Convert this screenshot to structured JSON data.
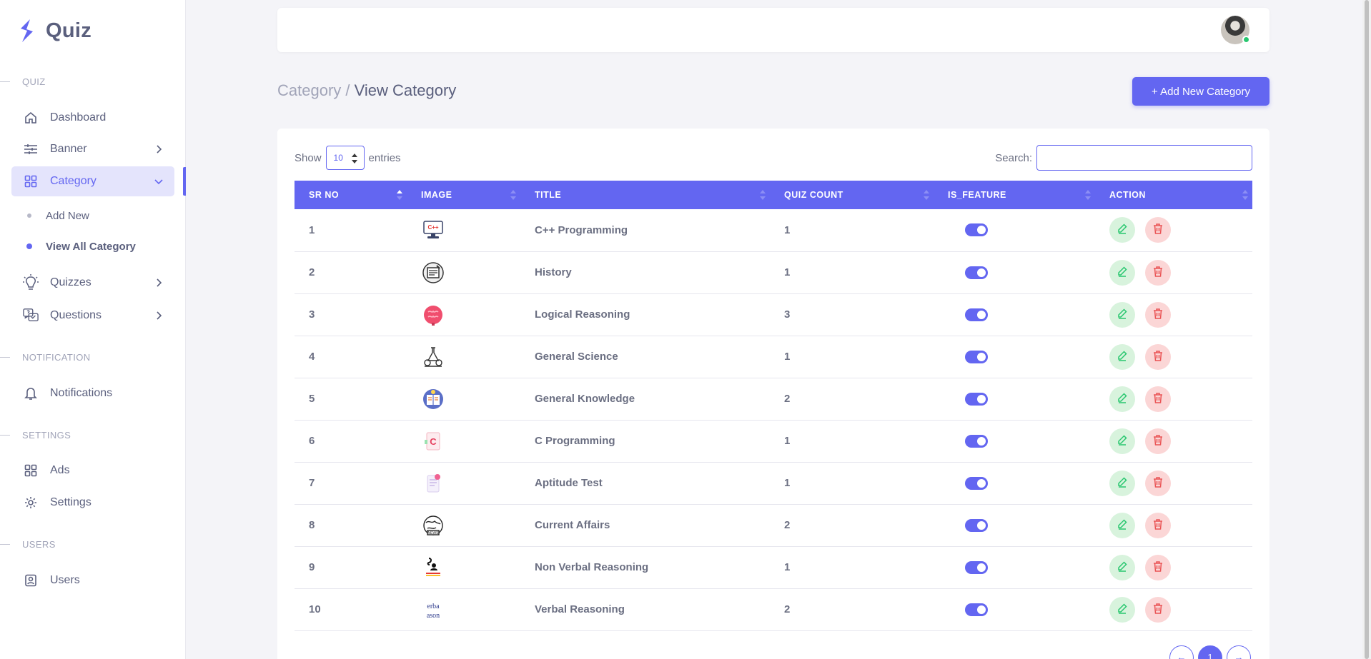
{
  "brand": {
    "name": "Quiz"
  },
  "sidebar": {
    "sections": {
      "quiz": "QUIZ",
      "notification": "NOTIFICATION",
      "settings": "SETTINGS",
      "users": "USERS"
    },
    "items": {
      "dashboard": "Dashboard",
      "banner": "Banner",
      "category": "Category",
      "add_new": "Add New",
      "view_all": "View All Category",
      "quizzes": "Quizzes",
      "questions": "Questions",
      "notifications": "Notifications",
      "ads": "Ads",
      "settings": "Settings",
      "users": "Users"
    }
  },
  "breadcrumb": {
    "parent": "Category",
    "sep": " / ",
    "current": "View Category"
  },
  "add_button": "+ Add New Category",
  "table_controls": {
    "show": "Show",
    "entries_value": "10",
    "entries": "entries",
    "search_label": "Search:"
  },
  "columns": [
    "SR NO",
    "IMAGE",
    "TITLE",
    "QUIZ COUNT",
    "IS_FEATURE",
    "ACTION"
  ],
  "rows": [
    {
      "sr": "1",
      "image_icon": "cpp-monitor-icon",
      "title": "C++ Programming",
      "count": "1",
      "featured": true
    },
    {
      "sr": "2",
      "image_icon": "history-book-icon",
      "title": "History",
      "count": "1",
      "featured": true
    },
    {
      "sr": "3",
      "image_icon": "brain-icon",
      "title": "Logical Reasoning",
      "count": "3",
      "featured": true
    },
    {
      "sr": "4",
      "image_icon": "science-icon",
      "title": "General Science",
      "count": "1",
      "featured": true
    },
    {
      "sr": "5",
      "image_icon": "knowledge-book-icon",
      "title": "General Knowledge",
      "count": "2",
      "featured": true
    },
    {
      "sr": "6",
      "image_icon": "c-file-icon",
      "title": "C Programming",
      "count": "1",
      "featured": true
    },
    {
      "sr": "7",
      "image_icon": "test-sheet-icon",
      "title": "Aptitude Test",
      "count": "1",
      "featured": true
    },
    {
      "sr": "8",
      "image_icon": "news-globe-icon",
      "title": "Current Affairs",
      "count": "2",
      "featured": true
    },
    {
      "sr": "9",
      "image_icon": "nonverbal-icon",
      "title": "Non Verbal Reasoning",
      "count": "1",
      "featured": true
    },
    {
      "sr": "10",
      "image_icon": "verbal-reasoning-icon",
      "title": "Verbal Reasoning",
      "count": "2",
      "featured": true
    }
  ],
  "pagination": {
    "prev": "←",
    "current": "1",
    "next": "→"
  },
  "colors": {
    "primary": "#6366f1",
    "edit_bg": "#d8f3dd",
    "edit_fg": "#28c76f",
    "delete_bg": "#fbd6d6",
    "delete_fg": "#ea5455"
  }
}
